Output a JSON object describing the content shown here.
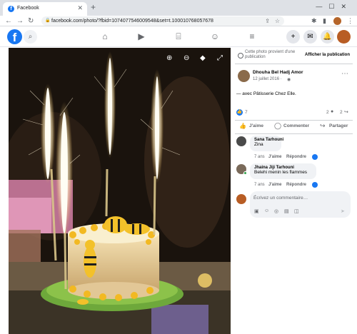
{
  "browser": {
    "tab_title": "Facebook",
    "url": "facebook.com/photo/?fbid=1074077546009548&set=t.100010768057678"
  },
  "photo_controls": [
    "zoom-in",
    "zoom-out",
    "tag",
    "fullscreen"
  ],
  "panel": {
    "notice_text": "Cette photo provient d'une publication",
    "notice_link": "Afficher la publication",
    "author": "Dhouha Bel Hadj Amor",
    "date": "12 juillet 2016 ·",
    "caption": "— avec Pâtisserie Chez Elle.",
    "reaction_count": "7",
    "comment_count": "2",
    "share_count": "2",
    "actions": {
      "like": "J'aime",
      "comment": "Commenter",
      "share": "Partager"
    },
    "comments": [
      {
        "name": "Sana Tarhouni",
        "text": "Zina",
        "time": "7 ans",
        "like": "J'aime",
        "reply": "Répondre"
      },
      {
        "name": "Jhaina Jiji Tarhouni",
        "text": "Belehi menin les flammes",
        "time": "7 ans",
        "like": "J'aime",
        "reply": "Répondre"
      }
    ],
    "write_placeholder": "Écrivez un commentaire…"
  },
  "colors": {
    "facebook_blue": "#1877f2",
    "like_blue": "#1877f2",
    "photo_bg": "#1c1510"
  }
}
